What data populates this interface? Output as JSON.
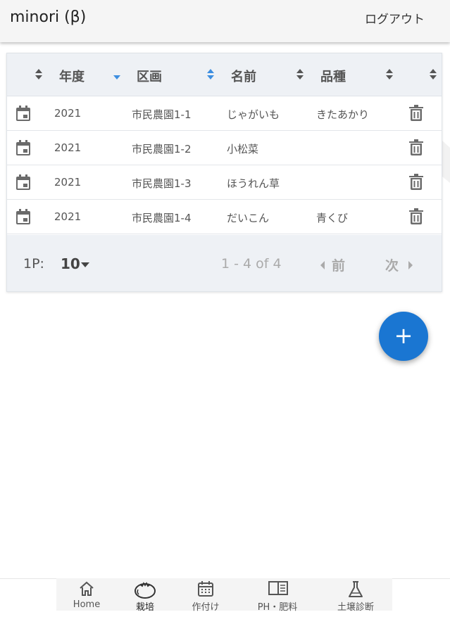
{
  "app": {
    "title": "minori (β)",
    "logout_label": "ログアウト"
  },
  "table": {
    "columns": [
      "年度",
      "区画",
      "名前",
      "品種"
    ],
    "rows": [
      {
        "year": "2021",
        "plot": "市民農園1-1",
        "name": "じゃがいも",
        "variety": "きたあかり"
      },
      {
        "year": "2021",
        "plot": "市民農園1-2",
        "name": "小松菜",
        "variety": ""
      },
      {
        "year": "2021",
        "plot": "市民農園1-3",
        "name": "ほうれん草",
        "variety": ""
      },
      {
        "year": "2021",
        "plot": "市民農園1-4",
        "name": "だいこん",
        "variety": "青くび"
      }
    ],
    "footer": {
      "per_page_label": "1P:",
      "per_page_value": "10",
      "range": "1 - 4 of 4",
      "prev_label": "前",
      "next_label": "次"
    }
  },
  "fab": {
    "label": "+"
  },
  "bottom_nav": {
    "items": [
      {
        "label": "Home",
        "icon": "home-icon"
      },
      {
        "label": "栽培",
        "icon": "tomato-icon"
      },
      {
        "label": "作付け",
        "icon": "calendar-grid-icon"
      },
      {
        "label": "PH・肥料",
        "icon": "book-icon"
      },
      {
        "label": "土壌診断",
        "icon": "flask-icon"
      }
    ],
    "active_index": 1
  },
  "colors": {
    "accent": "#1a76d2",
    "sort_active": "#3d8ee0",
    "header_bg": "#eef1f5"
  }
}
